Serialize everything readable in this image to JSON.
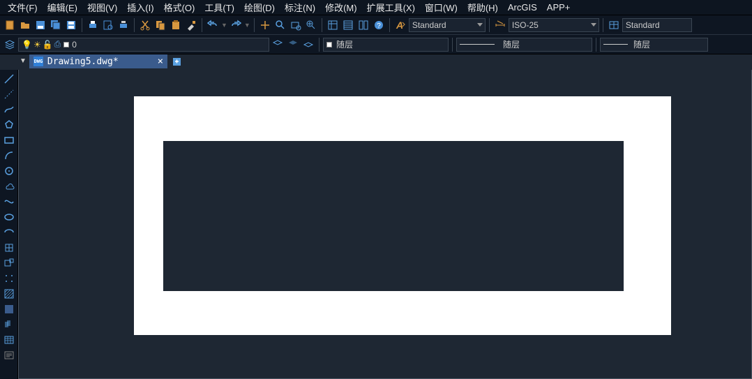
{
  "menu": {
    "file": "文件(F)",
    "edit": "编辑(E)",
    "view": "视图(V)",
    "insert": "插入(I)",
    "format": "格式(O)",
    "tools": "工具(T)",
    "draw": "绘图(D)",
    "annotate": "标注(N)",
    "modify": "修改(M)",
    "extend": "扩展工具(X)",
    "window": "窗口(W)",
    "help": "帮助(H)",
    "arcgis": "ArcGIS",
    "appplus": "APP+"
  },
  "toolbar1": {
    "text_style": "Standard",
    "dim_style": "ISO-25",
    "table_style": "Standard"
  },
  "layerbar": {
    "layer_name": "0",
    "color_label": "随层",
    "linetype_label": "随层",
    "lineweight_label": "随层"
  },
  "tab": {
    "filename": "Drawing5.dwg*",
    "icon_text": "DWG"
  }
}
